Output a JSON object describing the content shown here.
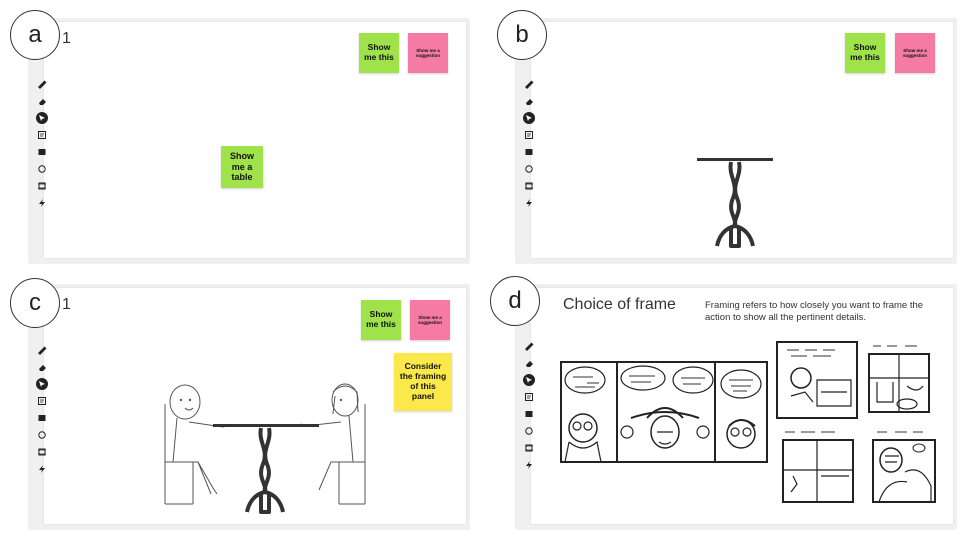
{
  "panels": {
    "a": {
      "badge": "a",
      "page_number": "1",
      "stickies": {
        "show_this": "Show me this",
        "suggestion": "Show me a suggestion",
        "table": "Show me a table"
      }
    },
    "b": {
      "badge": "b",
      "page_number": "",
      "stickies": {
        "show_this": "Show me this",
        "suggestion": "Show me a suggestion"
      }
    },
    "c": {
      "badge": "c",
      "page_number": "1",
      "stickies": {
        "show_this": "Show me this",
        "suggestion": "Show me a suggestion",
        "framing": "Consider the framing of this panel"
      }
    },
    "d": {
      "badge": "d",
      "title": "Choice of frame",
      "description": "Framing refers to how closely you want to frame the action to show all the pertinent details."
    }
  },
  "toolbar_icons": [
    "pen-icon",
    "eraser-icon",
    "cursor-icon",
    "sticky-note-icon",
    "image-icon",
    "circle-icon",
    "frame-icon",
    "lightning-icon"
  ],
  "colors": {
    "green_sticky": "#9fe24a",
    "pink_sticky": "#f57aa4",
    "yellow_sticky": "#fbe84a",
    "board": "#f0f0f0"
  }
}
